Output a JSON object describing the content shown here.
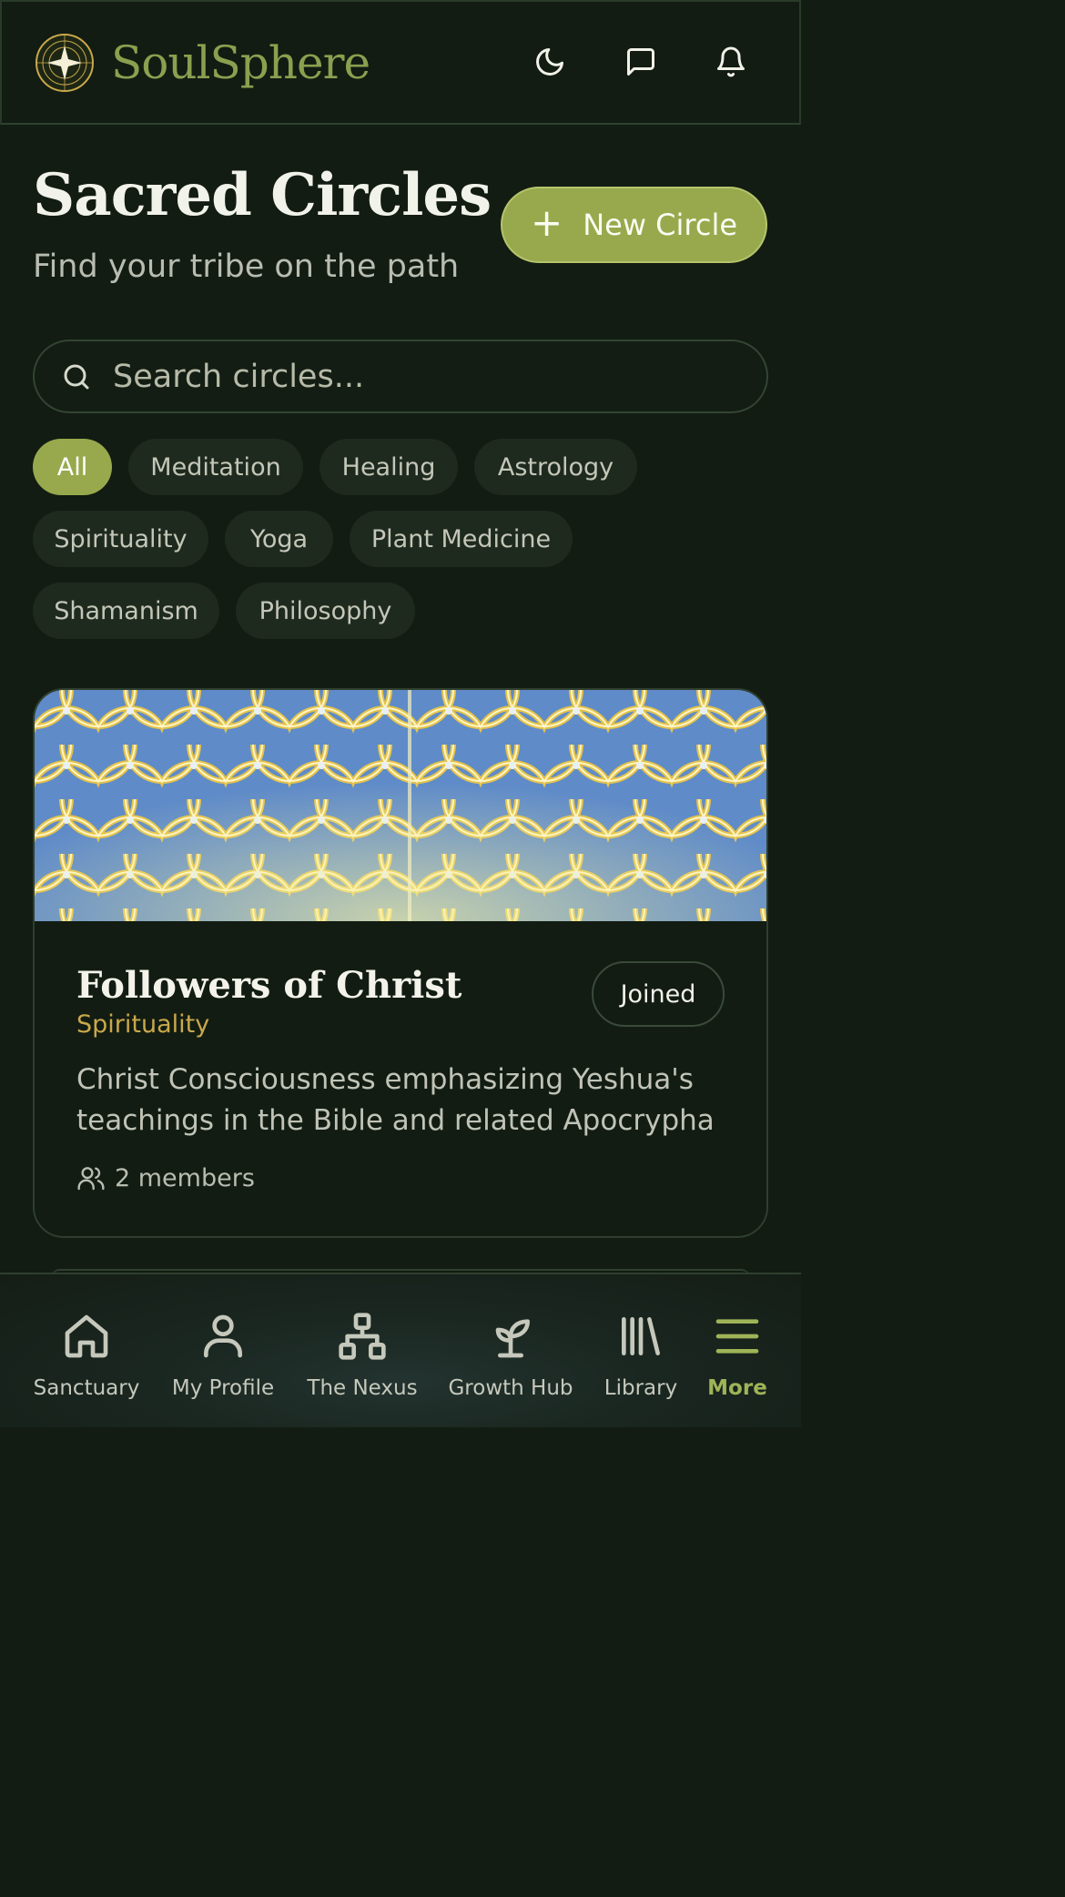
{
  "header": {
    "brand_name": "SoulSphere",
    "icons": [
      "star-logo-icon",
      "moon-icon",
      "message-icon",
      "bell-icon"
    ]
  },
  "page": {
    "title": "Sacred Circles",
    "subtitle": "Find your tribe on the path",
    "new_circle_label": "New Circle"
  },
  "search": {
    "placeholder": "Search circles..."
  },
  "filters": [
    {
      "label": "All",
      "active": true
    },
    {
      "label": "Meditation",
      "active": false
    },
    {
      "label": "Healing",
      "active": false
    },
    {
      "label": "Astrology",
      "active": false
    },
    {
      "label": "Spirituality",
      "active": false
    },
    {
      "label": "Yoga",
      "active": false
    },
    {
      "label": "Plant Medicine",
      "active": false
    },
    {
      "label": "Shamanism",
      "active": false
    },
    {
      "label": "Philosophy",
      "active": false
    }
  ],
  "circles": [
    {
      "title": "Followers of Christ",
      "category": "Spirituality",
      "status_label": "Joined",
      "description": "Christ Consciousness emphasizing Yeshua's teachings in the Bible and related Apocrypha",
      "members": "2 members"
    }
  ],
  "bottom_nav": [
    {
      "label": "Sanctuary",
      "icon": "home-icon",
      "active": false
    },
    {
      "label": "My Profile",
      "icon": "user-icon",
      "active": false
    },
    {
      "label": "The Nexus",
      "icon": "network-icon",
      "active": false
    },
    {
      "label": "Growth Hub",
      "icon": "sprout-icon",
      "active": false
    },
    {
      "label": "Library",
      "icon": "library-icon",
      "active": false
    },
    {
      "label": "More",
      "icon": "menu-icon",
      "active": true
    }
  ],
  "colors": {
    "background": "#121c12",
    "accent": "#98a94d",
    "brand_text": "#8aa04f",
    "category_gold": "#c9a84c"
  }
}
